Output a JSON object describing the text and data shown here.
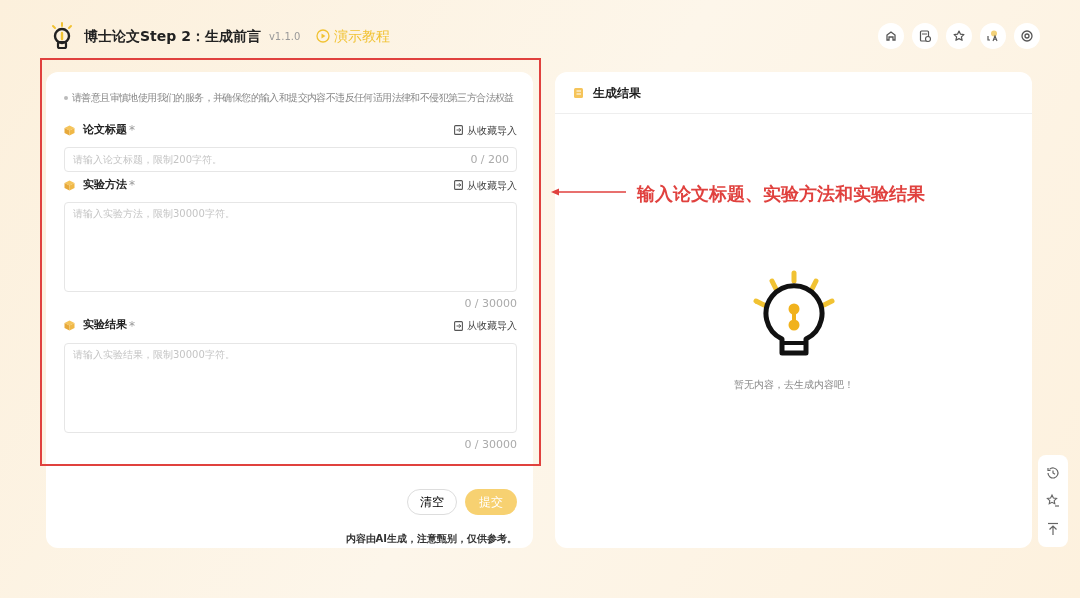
{
  "header": {
    "title": "博士论文Step 2：生成前言",
    "version": "v1.1.0",
    "tutorial": "演示教程"
  },
  "form": {
    "notice": "请善意且审慎地使用我们的服务，并确保您的输入和提交内容不违反任何适用法律和不侵犯第三方合法权益",
    "fields": [
      {
        "kind": "input",
        "label": "论文标题",
        "required_mark": "*",
        "import_label": "从收藏导入",
        "placeholder": "请输入论文标题，限制200字符。",
        "counter": "0 / 200"
      },
      {
        "kind": "textarea",
        "label": "实验方法",
        "required_mark": "*",
        "import_label": "从收藏导入",
        "placeholder": "请输入实验方法，限制30000字符。",
        "counter": "0 / 30000"
      },
      {
        "kind": "textarea",
        "label": "实验结果",
        "required_mark": "*",
        "import_label": "从收藏导入",
        "placeholder": "请输入实验结果，限制30000字符。",
        "counter": "0 / 30000"
      }
    ],
    "buttons": [
      {
        "kind": "secondary",
        "label": "清空",
        "disabled": false
      },
      {
        "kind": "primary",
        "label": "提交",
        "disabled": true
      }
    ],
    "disclaimer": "内容由AI生成，注意甄别，仅供参考。"
  },
  "result": {
    "title": "生成结果",
    "empty_text": "暂无内容，去生成内容吧！"
  },
  "annotation": {
    "text": "输入论文标题、实验方法和实验结果"
  }
}
